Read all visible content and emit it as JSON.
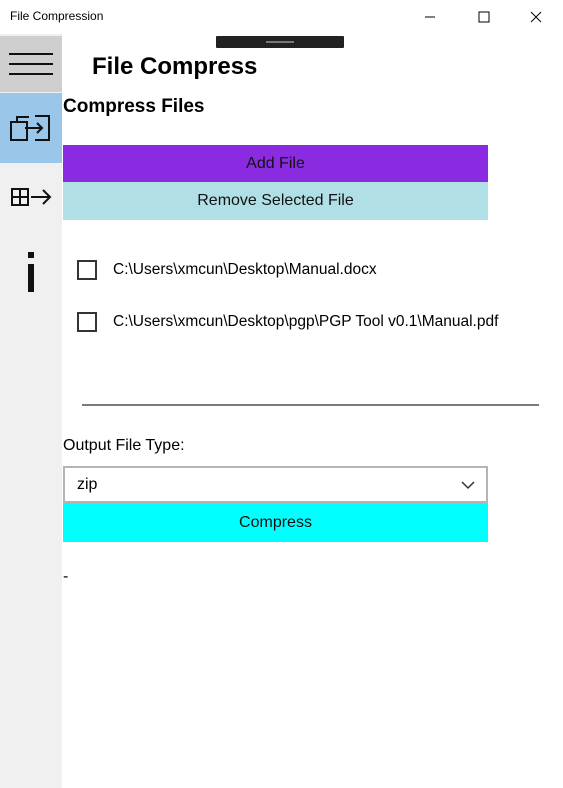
{
  "window": {
    "title": "File Compression",
    "controls": {
      "minimize": "minimize",
      "maximize": "maximize",
      "close": "close"
    }
  },
  "sidebar": {
    "items": [
      {
        "id": "menu",
        "icon": "hamburger-menu-icon",
        "selected": false
      },
      {
        "id": "compress",
        "icon": "compress-files-icon",
        "selected": true
      },
      {
        "id": "extract",
        "icon": "extract-files-icon",
        "selected": false
      },
      {
        "id": "about",
        "icon": "info-icon",
        "selected": false
      }
    ]
  },
  "header": {
    "app_title": "File Compress"
  },
  "main": {
    "section_title": "Compress Files",
    "add_file_label": "Add File",
    "remove_file_label": "Remove Selected File",
    "files": [
      {
        "path": "C:\\Users\\xmcun\\Desktop\\Manual.docx",
        "checked": false
      },
      {
        "path": "C:\\Users\\xmcun\\Desktop\\pgp\\PGP Tool v0.1\\Manual.pdf",
        "checked": false
      }
    ],
    "output_label": "Output File Type:",
    "output_type": "zip",
    "compress_label": "Compress",
    "status": "-"
  },
  "colors": {
    "add_button": "#8a2be2",
    "remove_button": "#b0e0e6",
    "compress_button": "#00ffff",
    "sidebar_selected": "#99c6e9",
    "sidebar_menu": "#cfcfcf",
    "sidebar_bg": "#f0f0f0"
  }
}
